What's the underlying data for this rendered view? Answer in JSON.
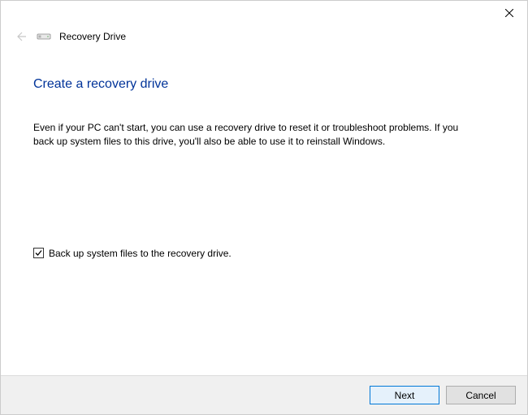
{
  "titlebar": {
    "close_label": "Close"
  },
  "header": {
    "back_label": "Back",
    "window_title": "Recovery Drive"
  },
  "main": {
    "heading": "Create a recovery drive",
    "body_text": "Even if your PC can't start, you can use a recovery drive to reset it or troubleshoot problems. If you back up system files to this drive, you'll also be able to use it to reinstall Windows.",
    "checkbox_label": "Back up system files to the recovery drive.",
    "checkbox_checked": true
  },
  "footer": {
    "next_label": "Next",
    "cancel_label": "Cancel"
  }
}
